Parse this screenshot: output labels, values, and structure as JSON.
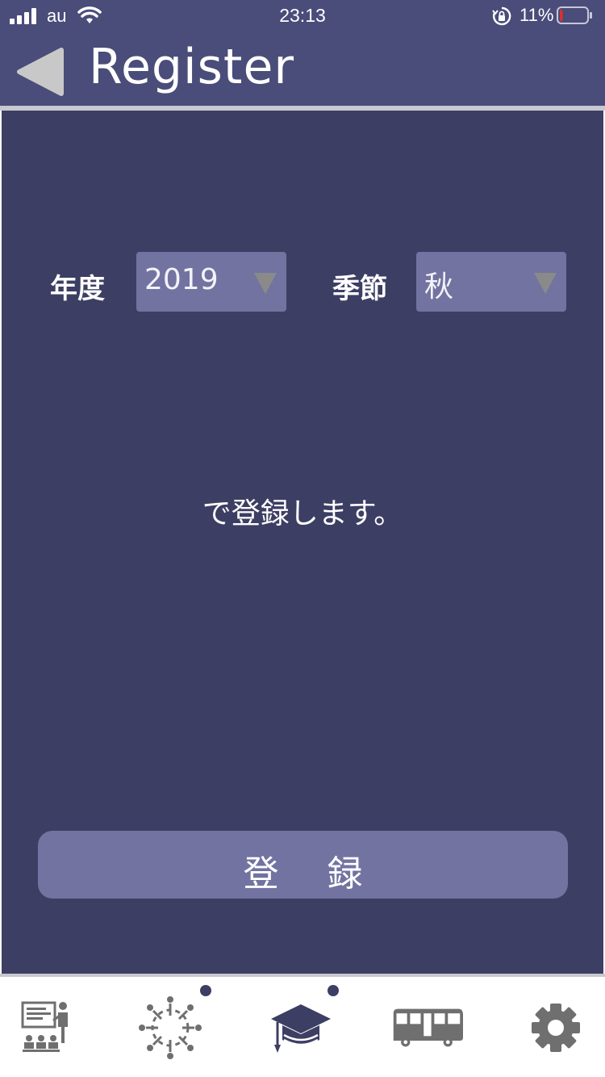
{
  "status_bar": {
    "carrier": "au",
    "time": "23:13",
    "battery_percent": "11%",
    "battery_level": 0.11,
    "battery_low_color": "#e0302a"
  },
  "header": {
    "title": "Register",
    "back_icon": "back-triangle-icon",
    "background_color": "#4a4c7a"
  },
  "form": {
    "year_label": "年度",
    "year_value": "2019",
    "season_label": "季節",
    "season_value": "秋",
    "message": "で登録します。",
    "register_button": "登録"
  },
  "colors": {
    "main_background": "#3d3e63",
    "control_background": "#7273a0"
  },
  "tabbar": {
    "tabs": [
      {
        "icon": "classroom-teacher-icon",
        "badge": false
      },
      {
        "icon": "people-circle-icon",
        "badge": true
      },
      {
        "icon": "graduation-cap-icon",
        "badge": true,
        "active": true
      },
      {
        "icon": "bus-icon",
        "badge": false
      },
      {
        "icon": "gear-icon",
        "badge": false
      }
    ]
  }
}
